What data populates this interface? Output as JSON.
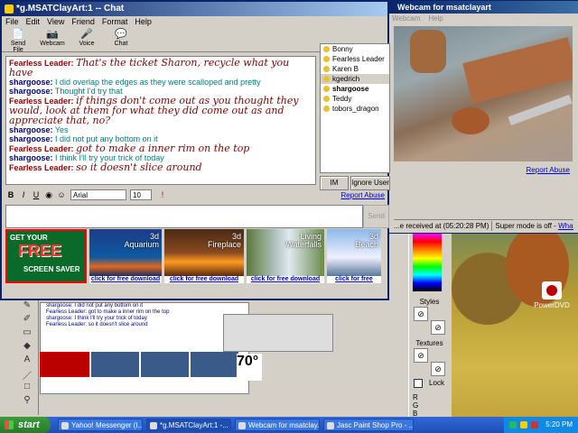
{
  "chat_window": {
    "title": "*g.MSATClayArt:1 -- Chat",
    "menu": [
      "File",
      "Edit",
      "View",
      "Friend",
      "Format",
      "Help"
    ],
    "toolbar": [
      {
        "label": "Send File",
        "icon": "send-file-icon",
        "glyph": "📄"
      },
      {
        "label": "Webcam",
        "icon": "webcam-icon",
        "glyph": "📷"
      },
      {
        "label": "Voice",
        "icon": "voice-icon",
        "glyph": "🎤"
      },
      {
        "label": "Chat",
        "icon": "chat-icon",
        "glyph": "💬"
      }
    ],
    "messages": [
      {
        "name": "Fearless Leader:",
        "text": "That's the ticket Sharon, recycle what you have",
        "style": "fl"
      },
      {
        "name": "shargoose:",
        "text": "I did overlap the edges as they were scalloped and pretty",
        "style": "sg"
      },
      {
        "name": "shargoose:",
        "text": "Thought I'd try that",
        "style": "sg"
      },
      {
        "name": "Fearless Leader:",
        "text": "if things don't come out as you thought they would, look at them for what they did come out as and appreciate that, no?",
        "style": "fl"
      },
      {
        "name": "shargoose:",
        "text": "Yes",
        "style": "sg"
      },
      {
        "name": "shargoose:",
        "text": "I did not put any bottom on it",
        "style": "sg"
      },
      {
        "name": "Fearless Leader:",
        "text": "got to make a inner rim on the top",
        "style": "fl"
      },
      {
        "name": "shargoose:",
        "text": "I think I'll try your trick of today",
        "style": "sg"
      },
      {
        "name": "Fearless Leader:",
        "text": "so it doesn't slice around",
        "style": "fl"
      }
    ],
    "users": [
      {
        "name": "Bonny",
        "selected": false,
        "bold": false
      },
      {
        "name": "Fearless Leader",
        "selected": false,
        "bold": false
      },
      {
        "name": "Karen B",
        "selected": false,
        "bold": false
      },
      {
        "name": "kgedrich",
        "selected": true,
        "bold": false
      },
      {
        "name": "shargoose",
        "selected": false,
        "bold": true
      },
      {
        "name": "Teddy",
        "selected": false,
        "bold": false
      },
      {
        "name": "tobors_dragon",
        "selected": false,
        "bold": false
      }
    ],
    "im_button": "IM",
    "ignore_button": "Ignore User",
    "format": {
      "bold": "B",
      "italic": "I",
      "underline": "U",
      "font": "Arial",
      "size": "10"
    },
    "report_abuse": "Report Abuse",
    "send_button": "Send",
    "ads": [
      {
        "title": "",
        "link": ""
      },
      {
        "title": "3d\nAquarium",
        "link": "click for free download"
      },
      {
        "title": "3d\nFireplace",
        "link": "click for free download"
      },
      {
        "title": "Living\nWaterfalls",
        "link": "click for free download"
      },
      {
        "title": "3d\nBeach",
        "link": "click for free download"
      }
    ],
    "ad_screensaver": {
      "line1": "GET YOUR",
      "line2": "FREE",
      "line3": "SCREEN SAVER"
    }
  },
  "webcam_window": {
    "title": "Webcam for msatclayart",
    "menu": [
      "Webcam",
      "Help"
    ],
    "report_abuse": "Report Abuse",
    "received": "...e received at (05:20:28 PM)",
    "super_mode": "Super mode is off -",
    "super_link": "What's this?"
  },
  "palette": {
    "styles": "Styles",
    "textures": "Textures",
    "lock": "Lock",
    "r": "R",
    "g": "G",
    "b": "B"
  },
  "bg_big_text": "70°",
  "desktop_icon": "PowerDVD",
  "taskbar": {
    "start": "start",
    "tasks": [
      {
        "label": "Yahoo! Messenger (I...",
        "active": false
      },
      {
        "label": "*g.MSATClayArt:1 -...",
        "active": true
      },
      {
        "label": "Webcam for msatclay...",
        "active": false
      },
      {
        "label": "Jasc Paint Shop Pro - ...",
        "active": false
      }
    ],
    "clock": "5:20 PM"
  }
}
